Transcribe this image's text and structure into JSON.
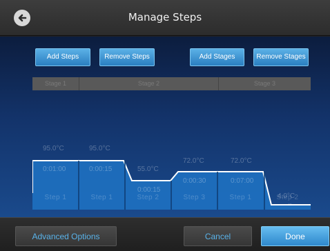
{
  "header": {
    "title": "Manage Steps",
    "back_icon": "arrow-left-circle-icon"
  },
  "toolbar": {
    "add_steps": "Add Steps",
    "remove_steps": "Remove Steps",
    "add_stages": "Add Stages",
    "remove_stages": "Remove Stages"
  },
  "stages": [
    "Stage 1",
    "Stage 2",
    "Stage 3"
  ],
  "steps": [
    {
      "label": "Step 1",
      "temp": "95.0°C",
      "time": "0:01:00",
      "temp_c": 95.0
    },
    {
      "label": "Step 1",
      "temp": "95.0°C",
      "time": "0:00:15",
      "temp_c": 95.0
    },
    {
      "label": "Step 2",
      "temp": "55.0°C",
      "time": "0:00:15",
      "temp_c": 55.0
    },
    {
      "label": "Step 3",
      "temp": "72.0°C",
      "time": "0:00:30",
      "temp_c": 72.0
    },
    {
      "label": "Step 1",
      "temp": "72.0°C",
      "time": "0:07:00",
      "temp_c": 72.0
    },
    {
      "label": "Step 2",
      "temp": "4.0°C",
      "time": "∞",
      "temp_c": 4.0
    }
  ],
  "footer": {
    "advanced": "Advanced Options",
    "cancel": "Cancel",
    "done": "Done"
  },
  "colors": {
    "accent": "#2f88cc",
    "profile_fill": "#1f73c4",
    "link_text": "#5ab3ea"
  }
}
